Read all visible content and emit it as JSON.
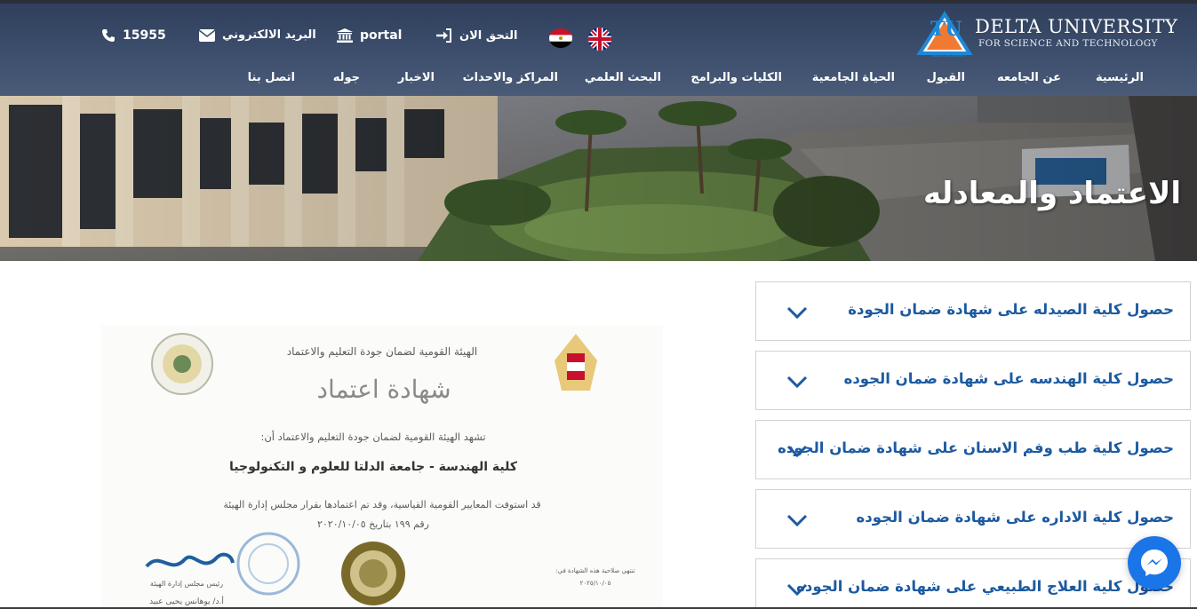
{
  "header": {
    "logo_title": "DELTA UNIVERSITY",
    "logo_subtitle": "FOR SCIENCE AND TECHNOLOGY",
    "logo_small_text": "DELTA UNIVERSITY",
    "topbar": {
      "phone": "15955",
      "email": "البريد الالكتروني",
      "portal": "portal",
      "verify": "التحق الان"
    },
    "nav": [
      "الرئيسية",
      "عن الجامعه",
      "القبول",
      "الحياة الجامعية",
      "الكليات والبرامج",
      "البحث العلمي",
      "المراكز والاحداث",
      "الاخبار",
      "جوله",
      "اتصل بنا"
    ]
  },
  "hero": {
    "title": "الاعتماد والمعادله"
  },
  "certificate": {
    "authority": "الهيئة القومية لضمان جودة التعليم والاعتماد",
    "heading": "شهادة اعتماد",
    "intro": "تشهد الهيئة القومية لضمان جودة التعليم والاعتماد أن:",
    "institution": "كلية الهندسة - جامعة الدلتا للعلوم و التكنولوجيا",
    "statement": "قد استوفت المعايير القومية القياسية، وقد تم اعتمادها بقرار مجلس إدارة الهيئة",
    "decision": "رقم ١٩٩ بتاريخ ٢٠٢٠/١٠/٠٥",
    "validity_label": "تنتهي صلاحية هذه الشهادة في:",
    "validity_date": "٢٠٢٥/١٠/٠٥",
    "signer_title": "رئيس مجلس إدارة الهيئة",
    "signer_name": "أ.د/ يوهانس يحيى عبيد"
  },
  "accordion": [
    "حصول كلية الصيدله على شهادة ضمان الجودة",
    "حصول كلية الهندسه على شهادة ضمان الجوده",
    "حصول كلية طب وفم الاسنان على شهادة ضمان الجوده",
    "حصول كلية الاداره على شهادة ضمان الجوده",
    "حصول كلية العلاج الطبيعي على شهادة ضمان الجوده"
  ],
  "colors": {
    "header": "#3d4f6d",
    "accordion_text": "#1c5aa0",
    "messenger": "#1a75e8"
  },
  "icons": [
    "phone-icon",
    "envelope-icon",
    "bank-icon",
    "sign-in-icon",
    "egypt-flag-icon",
    "uk-flag-icon",
    "chevron-down-icon",
    "messenger-icon"
  ]
}
